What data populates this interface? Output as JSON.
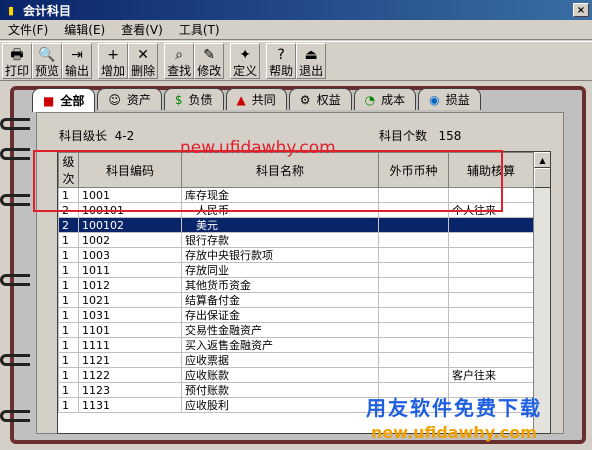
{
  "window": {
    "title": "会计科目",
    "close": "×"
  },
  "menu": [
    "文件(F)",
    "编辑(E)",
    "查看(V)",
    "工具(T)"
  ],
  "toolbar": [
    {
      "label": "打印",
      "icon": "🖶"
    },
    {
      "label": "预览",
      "icon": "🔍"
    },
    {
      "label": "输出",
      "icon": "⇥"
    },
    {
      "label": "增加",
      "icon": "+"
    },
    {
      "label": "删除",
      "icon": "✕"
    },
    {
      "label": "查找",
      "icon": "⌕"
    },
    {
      "label": "修改",
      "icon": "✎"
    },
    {
      "label": "定义",
      "icon": "✦"
    },
    {
      "label": "帮助",
      "icon": "?"
    },
    {
      "label": "退出",
      "icon": "⏏"
    }
  ],
  "tabs": [
    {
      "label": "全部",
      "icon": "■"
    },
    {
      "label": "资产",
      "icon": "☺"
    },
    {
      "label": "负债",
      "icon": "$"
    },
    {
      "label": "共同",
      "icon": "▲"
    },
    {
      "label": "权益",
      "icon": "⚙"
    },
    {
      "label": "成本",
      "icon": "◔"
    },
    {
      "label": "损益",
      "icon": "◉"
    }
  ],
  "info": {
    "level_label": "科目级长",
    "level_value": "4-2",
    "count_label": "科目个数",
    "count_value": "158"
  },
  "columns": [
    "级次",
    "科目编码",
    "科目名称",
    "外币币种",
    "辅助核算"
  ],
  "rows": [
    {
      "level": "1",
      "code": "1001",
      "name": "库存现金",
      "currency": "",
      "aux": "",
      "selected": false
    },
    {
      "level": "2",
      "code": "100101",
      "name": "人民币",
      "currency": "",
      "aux": "个人往来",
      "selected": false
    },
    {
      "level": "2",
      "code": "100102",
      "name": "美元",
      "currency": "",
      "aux": "",
      "selected": true
    },
    {
      "level": "1",
      "code": "1002",
      "name": "银行存款",
      "currency": "",
      "aux": "",
      "selected": false
    },
    {
      "level": "1",
      "code": "1003",
      "name": "存放中央银行款项",
      "currency": "",
      "aux": "",
      "selected": false
    },
    {
      "level": "1",
      "code": "1011",
      "name": "存放同业",
      "currency": "",
      "aux": "",
      "selected": false
    },
    {
      "level": "1",
      "code": "1012",
      "name": "其他货币资金",
      "currency": "",
      "aux": "",
      "selected": false
    },
    {
      "level": "1",
      "code": "1021",
      "name": "结算备付金",
      "currency": "",
      "aux": "",
      "selected": false
    },
    {
      "level": "1",
      "code": "1031",
      "name": "存出保证金",
      "currency": "",
      "aux": "",
      "selected": false
    },
    {
      "level": "1",
      "code": "1101",
      "name": "交易性金融资产",
      "currency": "",
      "aux": "",
      "selected": false
    },
    {
      "level": "1",
      "code": "1111",
      "name": "买入返售金融资产",
      "currency": "",
      "aux": "",
      "selected": false
    },
    {
      "level": "1",
      "code": "1121",
      "name": "应收票据",
      "currency": "",
      "aux": "",
      "selected": false
    },
    {
      "level": "1",
      "code": "1122",
      "name": "应收账款",
      "currency": "",
      "aux": "客户往来",
      "selected": false
    },
    {
      "level": "1",
      "code": "1123",
      "name": "预付账款",
      "currency": "",
      "aux": "",
      "selected": false
    },
    {
      "level": "1",
      "code": "1131",
      "name": "应收股利",
      "currency": "",
      "aux": "",
      "selected": false
    }
  ],
  "watermarks": {
    "line1": "new.ufidawhy.com",
    "line2": "用友软件免费下载",
    "line3": "new.ufidawhy.com"
  },
  "colors": {
    "selection": "#0a246a",
    "highlight_box": "#e0202a",
    "notebook_border": "#6b2e2e"
  }
}
